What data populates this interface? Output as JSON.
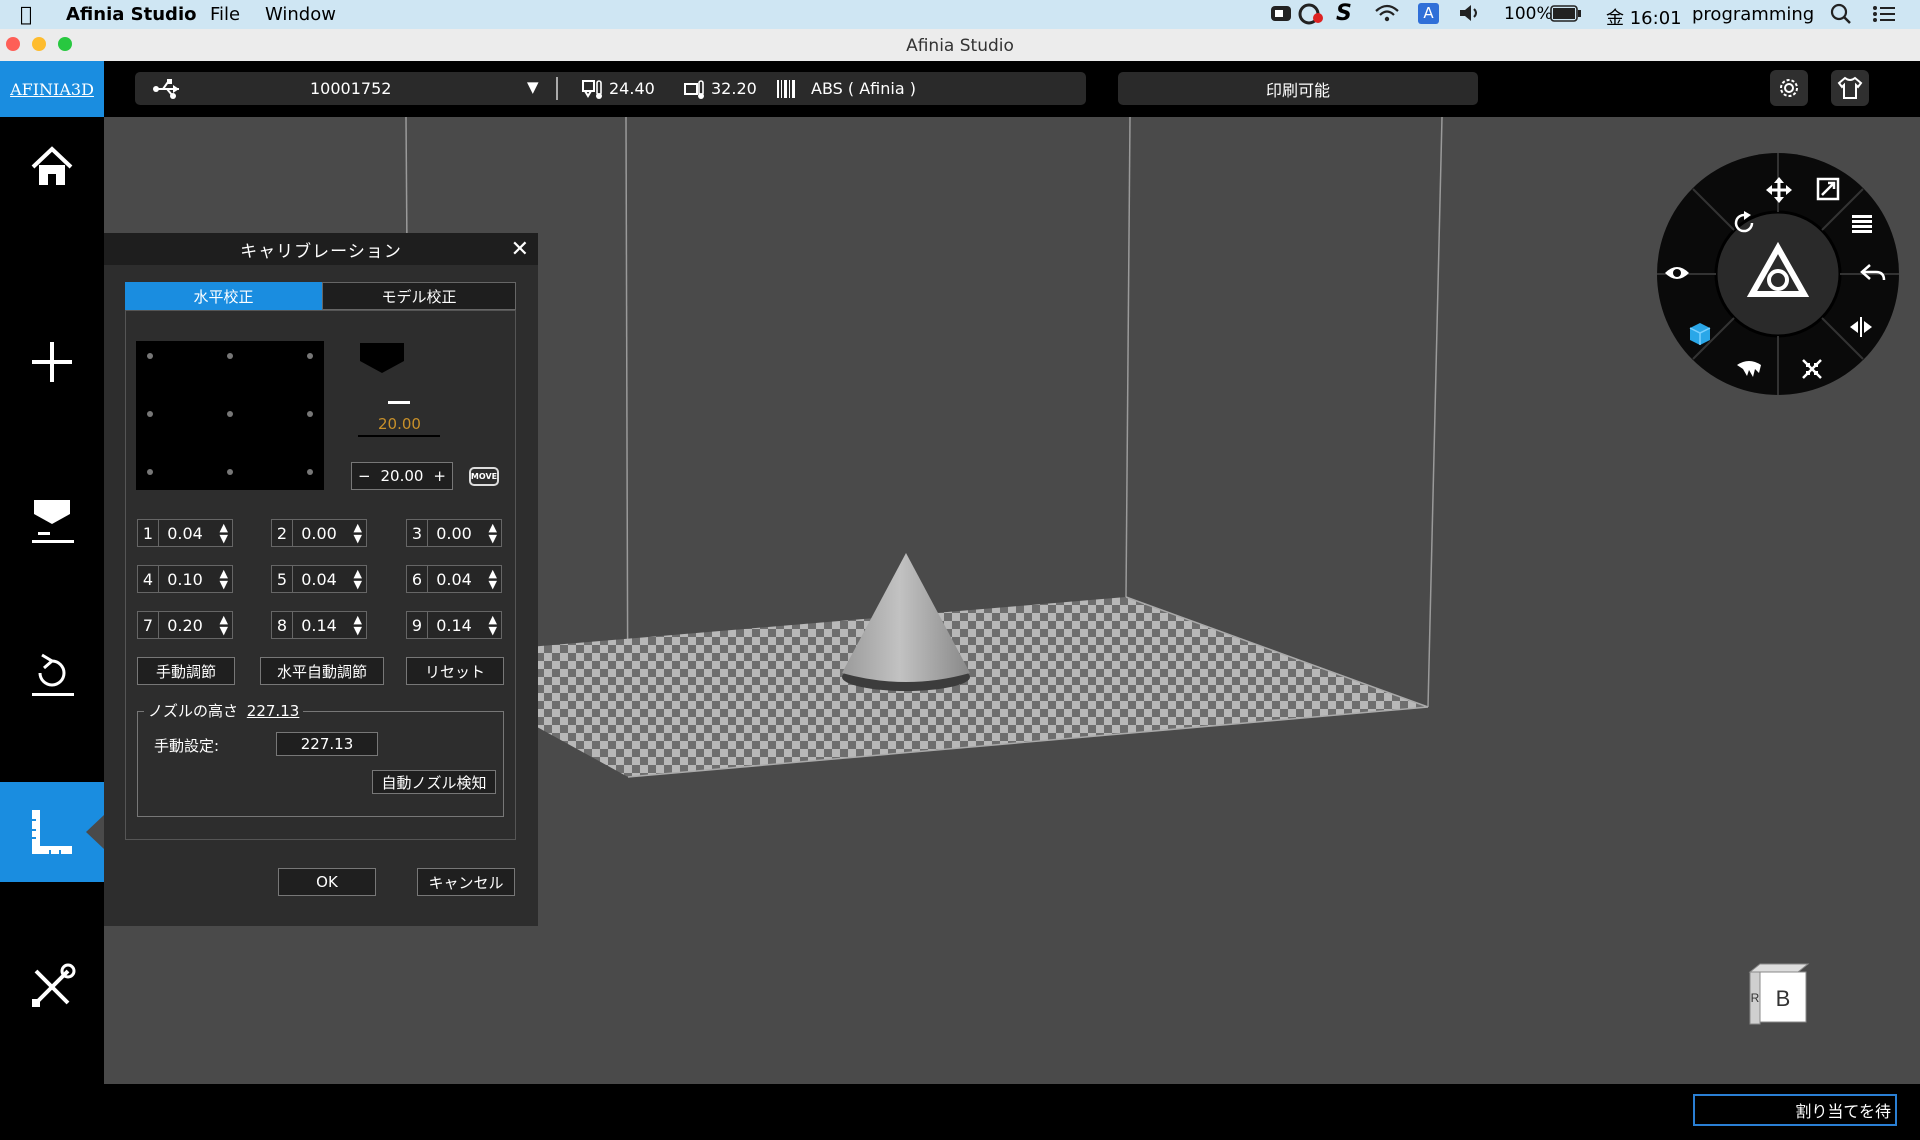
{
  "menubar": {
    "app_name": "Afinia Studio",
    "menus": [
      "File",
      "Window"
    ],
    "battery": "100%",
    "clock": "金 16:01",
    "user": "programming"
  },
  "window": {
    "title": "Afinia Studio"
  },
  "toolbar": {
    "logo": "AFINIA3D",
    "printer_id": "10001752",
    "nozzle_temp": "24.40",
    "bed_temp": "32.20",
    "material": "ABS ( Afinia )",
    "status": "印刷可能"
  },
  "dialog": {
    "title": "キャリブレーション",
    "tabs": [
      "水平校正",
      "モデル校正"
    ],
    "height_label": "20.00",
    "height_value": "20.00",
    "move_label": "MOVE",
    "points": [
      {
        "index": "1",
        "value": "0.04"
      },
      {
        "index": "2",
        "value": "0.00"
      },
      {
        "index": "3",
        "value": "0.00"
      },
      {
        "index": "4",
        "value": "0.10"
      },
      {
        "index": "5",
        "value": "0.04"
      },
      {
        "index": "6",
        "value": "0.04"
      },
      {
        "index": "7",
        "value": "0.20"
      },
      {
        "index": "8",
        "value": "0.14"
      },
      {
        "index": "9",
        "value": "0.14"
      }
    ],
    "manual_adjust": "手動調節",
    "auto_adjust": "水平自動調節",
    "reset": "リセット",
    "nozzle_group_label": "ノズルの高さ",
    "nozzle_height": "227.13",
    "manual_setting_label": "手動設定:",
    "manual_setting_value": "227.13",
    "auto_detect": "自動ノズル検知",
    "ok": "OK",
    "cancel": "キャンセル"
  },
  "view_cube": {
    "front": "B",
    "side": "R"
  },
  "bottom": {
    "field_text": "割り当てを待"
  }
}
